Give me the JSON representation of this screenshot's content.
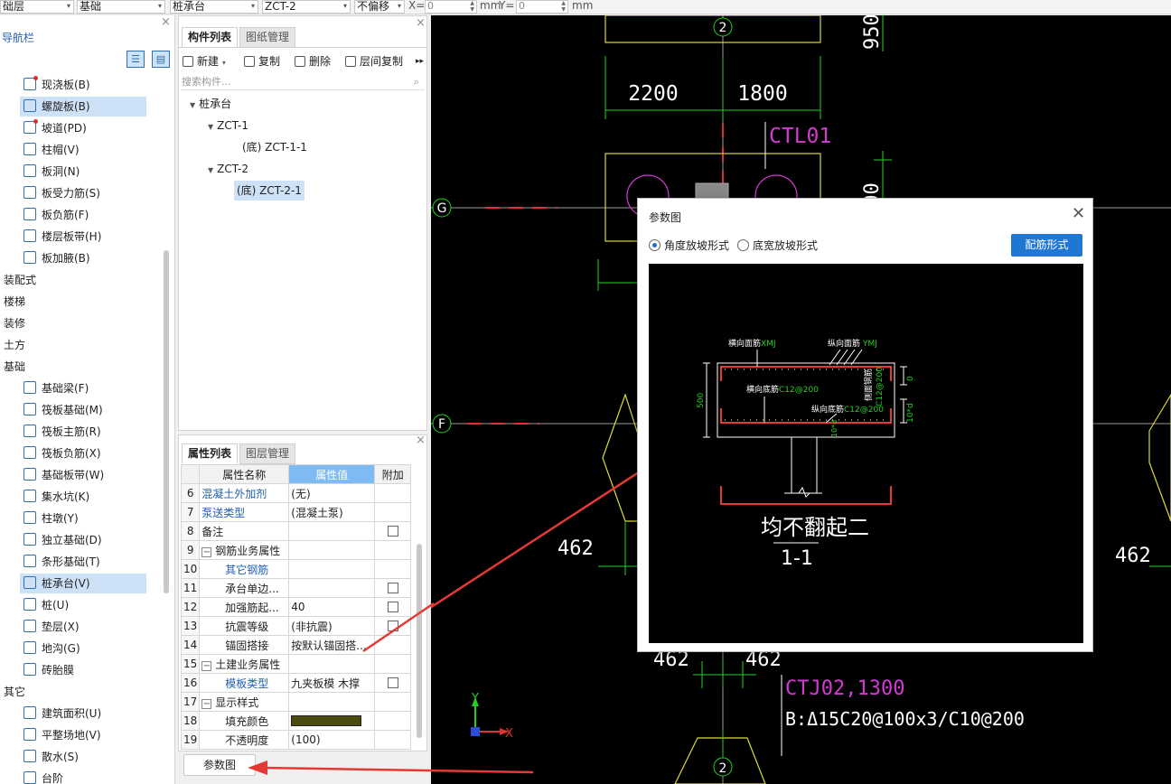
{
  "toolbar": {
    "floor_select": "础层",
    "category_select": "基础",
    "type_select": "桩承台",
    "component_select": "ZCT-2",
    "offset_select": "不偏移",
    "x_label": "X=",
    "x_value": "0",
    "x_unit": "mm",
    "y_label": "Y=",
    "y_value": "0",
    "y_unit": "mm"
  },
  "nav": {
    "title": "导航栏",
    "items": [
      {
        "label": "现浇板(B)",
        "dot": true
      },
      {
        "label": "螺旋板(B)",
        "selected": true
      },
      {
        "label": "坡道(PD)",
        "dot": true
      },
      {
        "label": "柱帽(V)"
      },
      {
        "label": "板洞(N)"
      },
      {
        "label": "板受力筋(S)"
      },
      {
        "label": "板负筋(F)"
      },
      {
        "label": "楼层板带(H)"
      },
      {
        "label": "板加腋(B)"
      }
    ],
    "categories": [
      "装配式",
      "楼梯",
      "装修",
      "土方",
      "基础"
    ],
    "foundation_items": [
      {
        "label": "基础梁(F)"
      },
      {
        "label": "筏板基础(M)"
      },
      {
        "label": "筏板主筋(R)"
      },
      {
        "label": "筏板负筋(X)"
      },
      {
        "label": "基础板带(W)"
      },
      {
        "label": "集水坑(K)"
      },
      {
        "label": "柱墩(Y)"
      },
      {
        "label": "独立基础(D)"
      },
      {
        "label": "条形基础(T)"
      },
      {
        "label": "桩承台(V)",
        "selected": true
      },
      {
        "label": "桩(U)"
      },
      {
        "label": "垫层(X)"
      },
      {
        "label": "地沟(G)"
      },
      {
        "label": "砖胎膜"
      }
    ],
    "other_category": "其它",
    "other_items": [
      {
        "label": "建筑面积(U)"
      },
      {
        "label": "平整场地(V)"
      },
      {
        "label": "散水(S)"
      },
      {
        "label": "台阶"
      }
    ]
  },
  "complist": {
    "tab_active": "构件列表",
    "tab_inactive": "图纸管理",
    "btn_new": "新建",
    "btn_copy": "复制",
    "btn_delete": "删除",
    "btn_floor_copy": "层间复制",
    "search_placeholder": "搜索构件...",
    "tree": {
      "root": "桩承台",
      "n1": "ZCT-1",
      "n1c": "(底) ZCT-1-1",
      "n2": "ZCT-2",
      "n2c": "(底) ZCT-2-1"
    }
  },
  "props": {
    "tab_active": "属性列表",
    "tab_inactive": "图层管理",
    "col_name": "属性名称",
    "col_value": "属性值",
    "col_extra": "附加",
    "rows": [
      {
        "n": "6",
        "name": "混凝土外加剂",
        "value": "(无)",
        "blue": true
      },
      {
        "n": "7",
        "name": "泵送类型",
        "value": "(混凝土泵)",
        "blue": true
      },
      {
        "n": "8",
        "name": "备注",
        "value": "",
        "cb": true
      },
      {
        "n": "9",
        "name": "钢筋业务属性",
        "value": "",
        "group": true
      },
      {
        "n": "10",
        "name": "其它钢筋",
        "value": "",
        "blue": true,
        "indent": true
      },
      {
        "n": "11",
        "name": "承台单边...",
        "value": "",
        "indent": true,
        "cb": true
      },
      {
        "n": "12",
        "name": "加强筋起...",
        "value": "40",
        "indent": true,
        "cb": true
      },
      {
        "n": "13",
        "name": "抗震等级",
        "value": "(非抗震)",
        "indent": true,
        "cb": true
      },
      {
        "n": "14",
        "name": "锚固搭接",
        "value": "按默认锚固搭...",
        "indent": true
      },
      {
        "n": "15",
        "name": "土建业务属性",
        "value": "",
        "group": true
      },
      {
        "n": "16",
        "name": "模板类型",
        "value": "九夹板模 木撑",
        "blue": true,
        "indent": true,
        "cb": true
      },
      {
        "n": "17",
        "name": "显示样式",
        "value": "",
        "group": true
      },
      {
        "n": "18",
        "name": "填充颜色",
        "value": "",
        "indent": true,
        "swatch": true
      },
      {
        "n": "19",
        "name": "不透明度",
        "value": "(100)",
        "indent": true
      }
    ],
    "param_button": "参数图"
  },
  "canvas": {
    "axis_2_top": "2",
    "axis_2_bottom": "2",
    "axis_g": "G",
    "axis_f": "F",
    "dim_2200": "2200",
    "dim_1800": "1800",
    "dim_950": "950",
    "dim_000": "000",
    "label_ctl01": "CTL01",
    "dim_462_left": "462",
    "dim_462_right": "462",
    "dim_462_b1": "462",
    "dim_462_b2": "462",
    "label_ctj02": "CTJ02,1300",
    "label_rebar": "B:Δ15C20@100x3/C10@200",
    "ucs_y": "Y",
    "ucs_x": "X"
  },
  "dialog": {
    "title": "参数图",
    "radio1": "角度放坡形式",
    "radio2": "底宽放坡形式",
    "rebar_button": "配筋形式",
    "diagram": {
      "top_cross": "横向面筋",
      "top_cross_code": "XMJ",
      "top_long": "纵向面筋",
      "top_long_code": "YMJ",
      "bot_cross": "横向底筋",
      "bot_cross_code": "C12@200",
      "bot_long": "纵向底筋",
      "bot_long_code": "C12@200",
      "height": "500",
      "dim_0": "0",
      "dim_10d": "10*d",
      "side_label": "侧面钢筋",
      "side_code": "C12@200",
      "side_10d": "10*d",
      "caption": "均不翻起二",
      "section": "1-1"
    }
  },
  "colors": {
    "canvas_bg": "#000000",
    "axis_green": "#1fd31f",
    "magenta": "#d23bd2",
    "yellow": "#d9d93a",
    "accent_blue": "#1f77d4",
    "arrow_red": "#e53935"
  }
}
